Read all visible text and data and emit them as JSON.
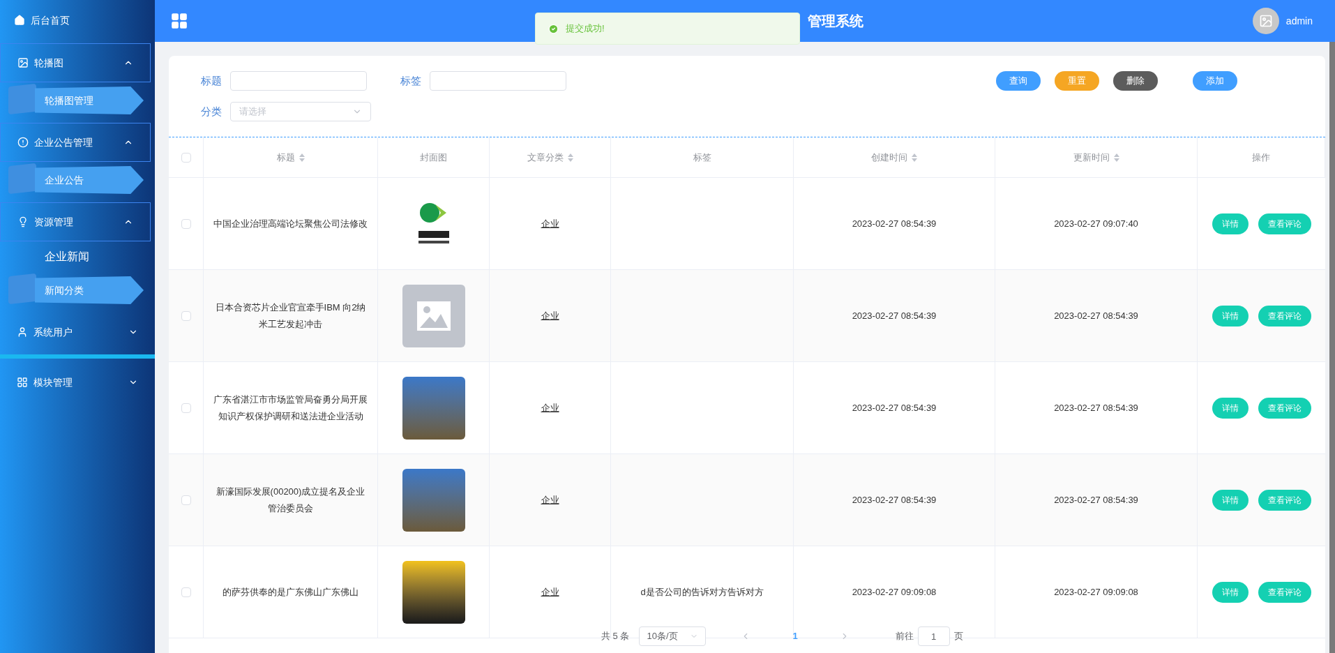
{
  "sidebar": {
    "items": [
      {
        "kind": "link",
        "label": "后台首页"
      },
      {
        "kind": "group",
        "label": "轮播图",
        "expanded": true,
        "children": [
          {
            "label": "轮播图管理",
            "selected": false
          }
        ]
      },
      {
        "kind": "group",
        "label": "企业公告管理",
        "expanded": true,
        "children": [
          {
            "label": "企业公告",
            "selected": false
          }
        ]
      },
      {
        "kind": "group",
        "label": "资源管理",
        "expanded": true,
        "children": [
          {
            "label": "企业新闻",
            "selected": true
          },
          {
            "label": "新闻分类",
            "selected": false
          }
        ]
      },
      {
        "kind": "group",
        "label": "系统用户",
        "expanded": false,
        "hovered": true
      },
      {
        "kind": "group",
        "label": "模块管理",
        "expanded": false
      }
    ]
  },
  "header": {
    "title": "管理系统",
    "user": "admin"
  },
  "toast": {
    "message": "提交成功!"
  },
  "filters": {
    "fields": [
      {
        "kind": "input",
        "label": "标题"
      },
      {
        "kind": "input",
        "label": "标签"
      },
      {
        "kind": "select",
        "label": "分类",
        "placeholder": "请选择"
      }
    ],
    "buttons": [
      {
        "label": "查询",
        "color": "#409eff"
      },
      {
        "label": "重置",
        "color": "#f5a623"
      },
      {
        "label": "删除",
        "color": "#5c5c5c"
      },
      {
        "label": "添加",
        "color": "#409eff"
      }
    ]
  },
  "table": {
    "all_checked": false,
    "columns": [
      {
        "label": "标题",
        "sortable": true
      },
      {
        "label": "封面图",
        "sortable": false
      },
      {
        "label": "文章分类",
        "sortable": true
      },
      {
        "label": "标签",
        "sortable": false
      },
      {
        "label": "创建时间",
        "sortable": true
      },
      {
        "label": "更新时间",
        "sortable": true
      },
      {
        "label": "操作",
        "sortable": false
      }
    ],
    "rows": [
      {
        "checked": false,
        "title": "中国企业治理高端论坛聚焦公司法修改",
        "cover": {
          "kind": "logo"
        },
        "category": "企业",
        "tag": "",
        "created": "2023-02-27 08:54:39",
        "updated": "2023-02-27 09:07:40",
        "actions": [
          "详情",
          "查看评论"
        ]
      },
      {
        "checked": false,
        "title": "日本合资芯片企业官宣牵手IBM 向2纳米工艺发起冲击",
        "cover": {
          "kind": "placeholder"
        },
        "category": "企业",
        "tag": "",
        "created": "2023-02-27 08:54:39",
        "updated": "2023-02-27 08:54:39",
        "actions": [
          "详情",
          "查看评论"
        ]
      },
      {
        "checked": false,
        "title": "广东省湛江市市场监管局奋勇分局开展知识产权保护调研和送法进企业活动",
        "cover": {
          "kind": "photo"
        },
        "category": "企业",
        "tag": "",
        "created": "2023-02-27 08:54:39",
        "updated": "2023-02-27 08:54:39",
        "actions": [
          "详情",
          "查看评论"
        ]
      },
      {
        "checked": false,
        "title": "新濠国际发展(00200)成立提名及企业管治委员会",
        "cover": {
          "kind": "photo"
        },
        "category": "企业",
        "tag": "",
        "created": "2023-02-27 08:54:39",
        "updated": "2023-02-27 08:54:39",
        "actions": [
          "详情",
          "查看评论"
        ]
      },
      {
        "checked": false,
        "title": "的萨芬供奉的是广东佛山广东佛山",
        "cover": {
          "kind": "poster"
        },
        "category": "企业",
        "tag": "d是否公司的告诉对方告诉对方",
        "created": "2023-02-27 09:09:08",
        "updated": "2023-02-27 09:09:08",
        "actions": [
          "详情",
          "查看评论"
        ]
      }
    ]
  },
  "pagination": {
    "total": "共 5 条",
    "page_size": "10条/页",
    "pages": [
      {
        "label": "1",
        "selected": true
      }
    ],
    "goto_label": "前往",
    "goto_value": "1",
    "goto_suffix": "页"
  }
}
